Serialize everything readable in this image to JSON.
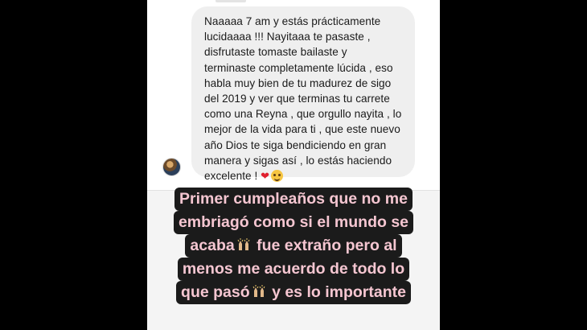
{
  "message": {
    "lines": [
      "Naaaaa 7 am y estás prácticamente",
      "lucidaaaa !!! Nayitaaa te pasaste ,",
      "disfrutaste tomaste bailaste y",
      "terminaste completamente lúcida , eso",
      "habla muy bien de tu madurez de sigo",
      "del 2019 y ver que terminas tu carrete",
      "como una Reyna , que orgullo nayita , lo",
      "mejor de la vida para ti , que este nuevo",
      "año Dios te siga bendiciendo en gran",
      "manera y sigas así , lo estás haciendo"
    ],
    "last_line_text": "excelente !",
    "emojis": [
      "heart-emoji",
      "smiling-face-with-hearts-emoji"
    ]
  },
  "caption": {
    "line1": "Primer cumpleaños que no me",
    "line2": "embriagó como si el mundo se",
    "line3a": "acaba",
    "line3b": " fue extraño pero al",
    "line4": "menos me acuerdo de todo lo",
    "line5a": "que pasó",
    "line5b": " y es lo importante",
    "icons": [
      "raising-hands-icon"
    ]
  },
  "colors": {
    "outer_background": "#000000",
    "bubble_background": "#efefef",
    "caption_background": "#1b1b1b",
    "caption_text": "#f5c6d1"
  }
}
